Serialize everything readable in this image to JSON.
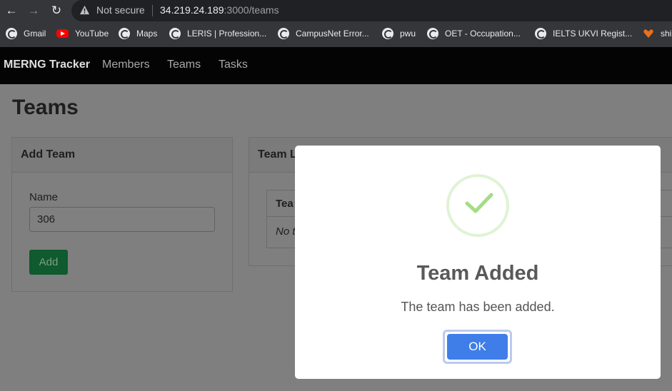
{
  "browser": {
    "not_secure": "Not secure",
    "url_host": "34.219.24.189",
    "url_rest": ":3000/teams",
    "bookmarks": [
      {
        "label": "Gmail",
        "icon": "globe-icon"
      },
      {
        "label": "YouTube",
        "icon": "youtube-icon"
      },
      {
        "label": "Maps",
        "icon": "globe-icon"
      },
      {
        "label": "LERIS | Profession...",
        "icon": "globe-icon"
      },
      {
        "label": "CampusNet Error...",
        "icon": "globe-icon"
      },
      {
        "label": "pwu",
        "icon": "globe-icon"
      },
      {
        "label": "OET - Occupation...",
        "icon": "globe-icon"
      },
      {
        "label": "IELTS UKVI Regist...",
        "icon": "globe-icon"
      },
      {
        "label": "shi",
        "icon": "heart-icon"
      }
    ]
  },
  "navbar": {
    "brand": "MERNG Tracker",
    "links": [
      "Members",
      "Teams",
      "Tasks"
    ]
  },
  "page": {
    "title": "Teams",
    "add_card": {
      "header": "Add Team",
      "name_label": "Name",
      "name_value": "306",
      "add_button": "Add"
    },
    "list_card": {
      "header": "Team L",
      "column_header": "Tea",
      "empty_text": "No t"
    }
  },
  "modal": {
    "title": "Team Added",
    "message": "The team has been added.",
    "ok_label": "OK",
    "success_color": "#a5dc86",
    "button_color": "#3f7ee8"
  }
}
